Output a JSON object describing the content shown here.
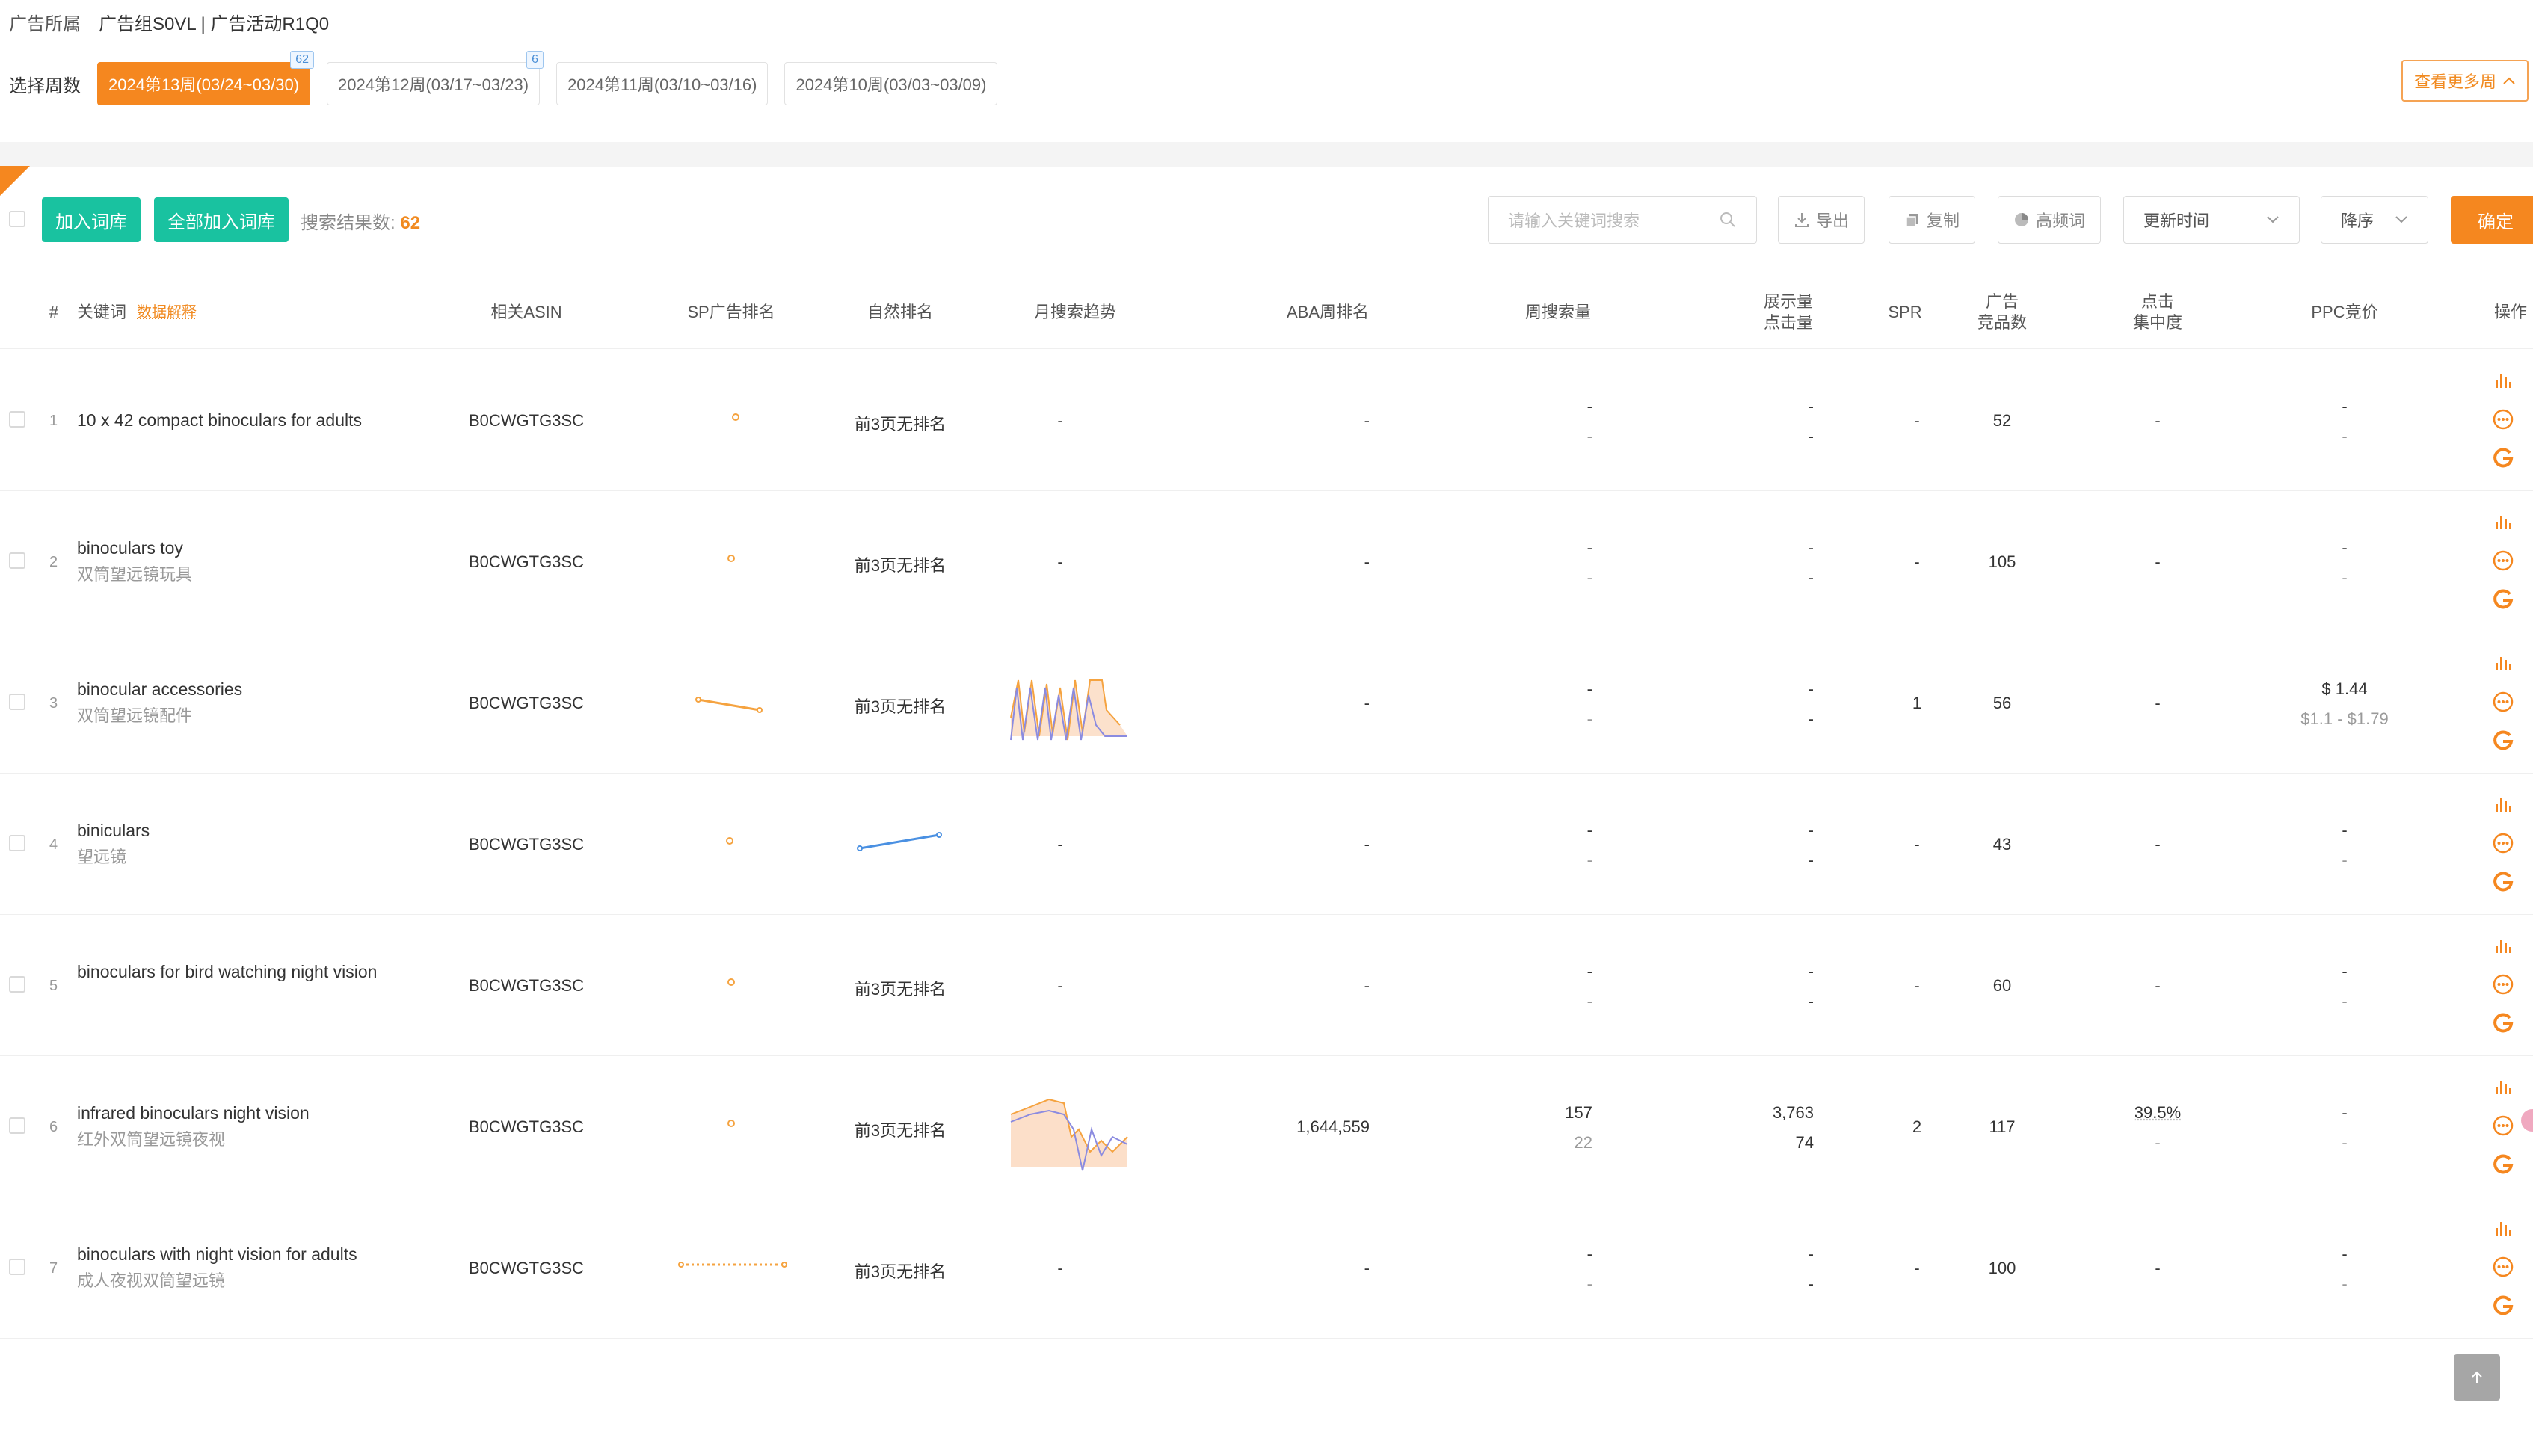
{
  "header": {
    "ad_owner_label": "广告所属",
    "ad_owner_value": "广告组S0VL | 广告活动R1Q0"
  },
  "weeks": {
    "label": "选择周数",
    "items": [
      {
        "label": "2024第13周(03/24~03/30)",
        "badge": "62",
        "active": true
      },
      {
        "label": "2024第12周(03/17~03/23)",
        "badge": "6",
        "active": false
      },
      {
        "label": "2024第11周(03/10~03/16)",
        "badge": "",
        "active": false
      },
      {
        "label": "2024第10周(03/03~03/09)",
        "badge": "",
        "active": false
      }
    ],
    "more_label": "查看更多周"
  },
  "toolbar": {
    "add_label": "加入词库",
    "add_all_label": "全部加入词库",
    "result_label": "搜索结果数:",
    "result_count": "62",
    "search_placeholder": "请输入关键词搜索",
    "export_label": "导出",
    "copy_label": "复制",
    "high_freq_label": "高频词",
    "sort_field": "更新时间",
    "sort_order": "降序",
    "confirm_label": "确定"
  },
  "table": {
    "headers": {
      "index": "#",
      "keyword": "关键词",
      "explain": "数据解释",
      "asin": "相关ASIN",
      "sp_rank": "SP广告排名",
      "natural_rank": "自然排名",
      "trend": "月搜索趋势",
      "aba_rank": "ABA周排名",
      "weekly_search": "周搜索量",
      "impressions_1": "展示量",
      "impressions_2": "点击量",
      "spr": "SPR",
      "ad_products_1": "广告",
      "ad_products_2": "竞品数",
      "click_1": "点击",
      "click_2": "集中度",
      "ppc": "PPC竞价",
      "actions": "操作"
    },
    "rows": [
      {
        "num": "1",
        "kw": "10 x 42 compact binoculars for adults",
        "cn": "",
        "asin": "B0CWGTG3SC",
        "natural": "前3页无排名",
        "trend": "-",
        "aba": "-",
        "search1": "-",
        "search2": "-",
        "imp1": "-",
        "imp2": "-",
        "spr": "-",
        "products": "52",
        "click1": "-",
        "click2": "",
        "ppc1": "-",
        "ppc2": "-"
      },
      {
        "num": "2",
        "kw": "binoculars toy",
        "cn": "双筒望远镜玩具",
        "asin": "B0CWGTG3SC",
        "natural": "前3页无排名",
        "trend": "-",
        "aba": "-",
        "search1": "-",
        "search2": "-",
        "imp1": "-",
        "imp2": "-",
        "spr": "-",
        "products": "105",
        "click1": "-",
        "click2": "",
        "ppc1": "-",
        "ppc2": "-"
      },
      {
        "num": "3",
        "kw": "binocular accessories",
        "cn": "双筒望远镜配件",
        "asin": "B0CWGTG3SC",
        "natural": "前3页无排名",
        "trend": "",
        "aba": "-",
        "search1": "-",
        "search2": "-",
        "imp1": "-",
        "imp2": "-",
        "spr": "1",
        "products": "56",
        "click1": "-",
        "click2": "",
        "ppc1": "$ 1.44",
        "ppc2": "$1.1 - $1.79"
      },
      {
        "num": "4",
        "kw": "biniculars",
        "cn": "望远镜",
        "asin": "B0CWGTG3SC",
        "natural": "",
        "trend": "-",
        "aba": "-",
        "search1": "-",
        "search2": "-",
        "imp1": "-",
        "imp2": "-",
        "spr": "-",
        "products": "43",
        "click1": "-",
        "click2": "",
        "ppc1": "-",
        "ppc2": "-"
      },
      {
        "num": "5",
        "kw": "binoculars for bird watching night vision",
        "cn": "",
        "asin": "B0CWGTG3SC",
        "natural": "前3页无排名",
        "trend": "-",
        "aba": "-",
        "search1": "-",
        "search2": "-",
        "imp1": "-",
        "imp2": "-",
        "spr": "-",
        "products": "60",
        "click1": "-",
        "click2": "",
        "ppc1": "-",
        "ppc2": "-"
      },
      {
        "num": "6",
        "kw": "infrared binoculars night vision",
        "cn": "红外双筒望远镜夜视",
        "asin": "B0CWGTG3SC",
        "natural": "前3页无排名",
        "trend": "",
        "aba": "1,644,559",
        "search1": "157",
        "search2": "22",
        "imp1": "3,763",
        "imp2": "74",
        "spr": "2",
        "products": "117",
        "click1": "39.5%",
        "click2": "-",
        "ppc1": "-",
        "ppc2": "-"
      },
      {
        "num": "7",
        "kw": "binoculars with night vision for adults",
        "cn": "成人夜视双筒望远镜",
        "asin": "B0CWGTG3SC",
        "natural": "前3页无排名",
        "trend": "-",
        "aba": "-",
        "search1": "-",
        "search2": "-",
        "imp1": "-",
        "imp2": "-",
        "spr": "-",
        "products": "100",
        "click1": "-",
        "click2": "",
        "ppc1": "-",
        "ppc2": "-"
      }
    ]
  },
  "colors": {
    "accent": "#f5871f",
    "green": "#19c2a0",
    "blue_line": "#4a90e2",
    "purple_line": "#8b8be0"
  },
  "icons": {
    "bar_chart": "bar-chart-icon",
    "more": "more-circle-icon",
    "google": "google-g-icon",
    "search": "search-icon",
    "download": "download-icon",
    "copy": "copy-icon",
    "pie": "pie-chart-icon",
    "chevron_down": "chevron-down-icon",
    "chevron_up": "chevron-up-icon",
    "arrow_up": "arrow-up-icon"
  }
}
